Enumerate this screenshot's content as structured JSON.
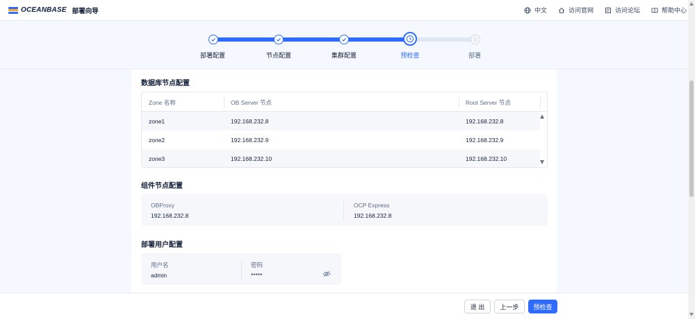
{
  "header": {
    "logo_text": "OCEANBASE",
    "app_name": "部署向导",
    "nav": [
      {
        "label": "中文",
        "icon": "globe-icon"
      },
      {
        "label": "访问官网",
        "icon": "home-icon"
      },
      {
        "label": "访问论坛",
        "icon": "forum-icon"
      },
      {
        "label": "帮助中心",
        "icon": "book-icon"
      }
    ]
  },
  "steps": {
    "items": [
      {
        "label": "部署配置",
        "state": "done"
      },
      {
        "label": "节点配置",
        "state": "done"
      },
      {
        "label": "集群配置",
        "state": "done"
      },
      {
        "label": "预检查",
        "state": "current"
      },
      {
        "label": "部署",
        "state": "pending"
      }
    ],
    "progress": 0.75
  },
  "db_section": {
    "title": "数据库节点配置",
    "columns": [
      "Zone 名称",
      "OB Server 节点",
      "Root Server 节点"
    ],
    "rows": [
      [
        "zone1",
        "192.168.232.8",
        "192.168.232.8"
      ],
      [
        "zone2",
        "192.168.232.9",
        "192.168.232.9"
      ],
      [
        "zone3",
        "192.168.232.10",
        "192.168.232.10"
      ]
    ]
  },
  "component_section": {
    "title": "组件节点配置",
    "items": [
      {
        "label": "OBProxy",
        "value": "192.168.232.8"
      },
      {
        "label": "OCP Express",
        "value": "192.168.232.8"
      }
    ]
  },
  "user_section": {
    "title": "部署用户配置",
    "username_label": "用户名",
    "username": "admin",
    "password_label": "密码",
    "password": "*****"
  },
  "footer": {
    "exit_label": "退 出",
    "prev_label": "上一步",
    "next_label": "预检查"
  },
  "colors": {
    "accent": "#2f6bff",
    "background": "#f5f8fe"
  }
}
